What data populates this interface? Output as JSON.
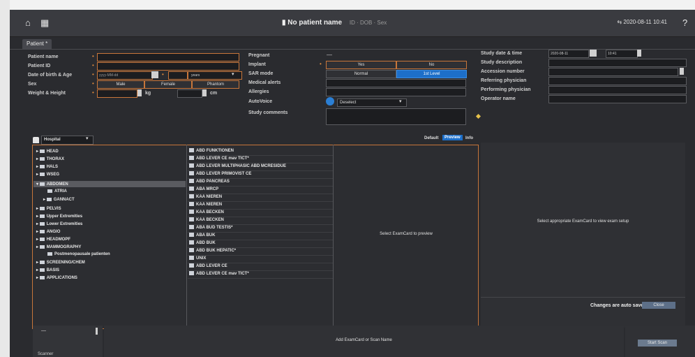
{
  "titlebar": {
    "title": "No patient name",
    "subtitle": "ID  ·  DOB  ·  Sex",
    "datetime": "2020-08-11 10:41"
  },
  "tabs": [
    {
      "label": "Patient *"
    }
  ],
  "form_left": {
    "patient_name": "Patient name",
    "patient_id": "Patient ID",
    "dob_age": "Date of birth & Age",
    "sex": "Sex",
    "weight_height": "Weight & Height",
    "dob_value": "yyyy-MM-dd",
    "age_unit": "years",
    "sex_options": [
      "Male",
      "Female",
      "Phantom"
    ],
    "weight_unit": "kg",
    "height_unit": "cm"
  },
  "form_middle": {
    "pregnant": "Pregnant",
    "pregnant_value": "—",
    "implant": "Implant",
    "implant_options": [
      "Yes",
      "No"
    ],
    "sar_mode": "SAR mode",
    "sar_options": [
      "Normal",
      "1st Level"
    ],
    "medical_alerts": "Medical alerts",
    "allergies": "Allergies",
    "autovoice": "AutoVoice",
    "autovoice_value": "Deselect",
    "study_comments": "Study comments"
  },
  "form_right": {
    "study_date_time": "Study date & time",
    "study_date_value": "2020-08-11",
    "study_time_value": "10:41",
    "study_description": "Study description",
    "accession_number": "Accession number",
    "referring_physician": "Referring physician",
    "performing_physician": "Performing physician",
    "operator_name": "Operator name"
  },
  "tree_toolbar": {
    "dropdown_value": "Hospital",
    "preview_tabs": [
      "Default",
      "Preview",
      "Info"
    ]
  },
  "tree": [
    "HEAD",
    "THORAX",
    "HALS",
    "WSEG",
    "ABDOMEN",
    "ATRIA",
    "GANNACT",
    "PELVIS",
    "Upper Extremities",
    "Lower Extremities",
    "ANGIO",
    "HEADMOPF",
    "MAMMOGRAPHY",
    "Postmenopausale patienten",
    "SCREENING/CHEM",
    "BASIS",
    "APPLICATIONS"
  ],
  "list": [
    "ABD FUNKTIONEN",
    "ABD LEVER CE mav TICT*",
    "ABD LEVER MULTIPHASIC ABD MCRESIDUE",
    "ABD LEVER PRIMOVIST CE",
    "ABD PANCREAS",
    "ABA MRCP",
    "KAA NIEREN",
    "KAA NIEREN",
    "KAA BECKEN",
    "KAA BECKEN",
    "ABA BUD TESTIS*",
    "ABA BUK",
    "ABD BUK",
    "ABD BUK HEPATIC*",
    "UNIX",
    "ABD LEVER CE",
    "ABD LEVER CE mav TICT*"
  ],
  "messages": {
    "select_preview": "Select ExamCard to preview",
    "select_appropriate": "Select appropriate ExamCard to view exam setup",
    "auto_saved": "Changes are auto saved",
    "close_label": "Close",
    "add_examcard": "Add ExamCard or Scan Name"
  },
  "bottom": {
    "status_label": "Scanner",
    "start_label": "Start Scan"
  },
  "colors": {
    "accent": "#c8763a",
    "selection": "#1d6fc9",
    "background": "#2a2b2f"
  }
}
